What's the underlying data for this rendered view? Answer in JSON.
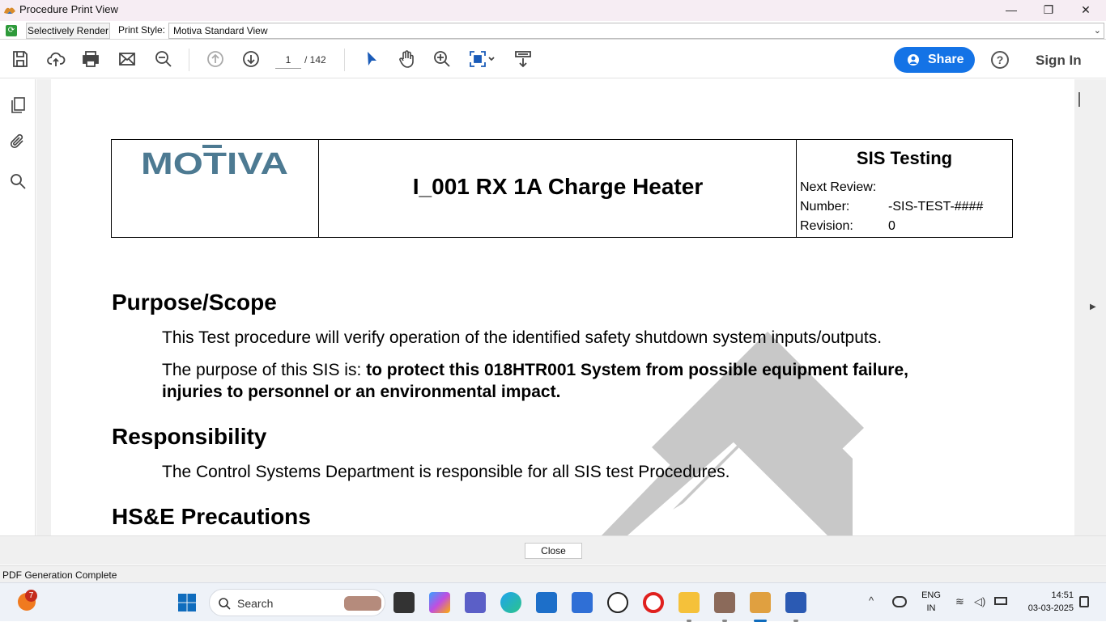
{
  "window": {
    "title": "Procedure Print View",
    "minimize": "—",
    "maximize": "❐",
    "close": "✕"
  },
  "selective_bar": {
    "render_button": "Selectively Render",
    "print_style_label": "Print Style:",
    "print_style_value": "Motiva Standard View"
  },
  "toolbar": {
    "page_current": "1",
    "page_total": "/  142",
    "share_label": "Share",
    "help_label": "?",
    "sign_in_label": "Sign In",
    "accent": "#1473e6"
  },
  "document": {
    "logo_text": "MOTIVA",
    "title": "I_001 RX 1A Charge Heater",
    "doc_type": "SIS Testing",
    "next_review_label": "Next Review:",
    "number_label": "Number:",
    "number_value": "-SIS-TEST-####",
    "revision_label": "Revision:",
    "revision_value": "0",
    "sections": {
      "purpose_heading": "Purpose/Scope",
      "purpose_p1": "This Test procedure will verify operation of the identified safety shutdown system inputs/outputs.",
      "purpose_p2_lead": "The purpose of this SIS is:",
      "purpose_p2_bold_line1": "to protect this 018HTR001 System from possible equipment failure,",
      "purpose_p2_bold_line2": "injuries to personnel or an environmental impact.",
      "responsibility_heading": "Responsibility",
      "responsibility_p1": "The Control Systems Department is responsible for all SIS test Procedures.",
      "hse_heading": "HS&E Precautions"
    }
  },
  "footer": {
    "close_label": "Close",
    "status_text": "PDF Generation Complete"
  },
  "taskbar": {
    "search_label": "Search",
    "notification_count": "7",
    "lang_top": "ENG",
    "lang_bottom": "IN",
    "time": "14:51",
    "date": "03-03-2025"
  }
}
